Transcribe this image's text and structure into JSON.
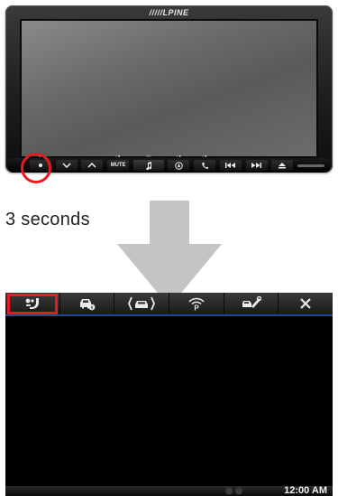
{
  "head_unit": {
    "brand": "/////LPINE",
    "buttons": {
      "power_sub": "•••",
      "mute_label": "MUTE",
      "mute_sub": "•◄",
      "music_sub": "•≡•",
      "nav_sub": "•◄",
      "phone_sub": "•◄"
    }
  },
  "caption": "3 seconds",
  "settings_screen": {
    "tabs": [
      {
        "name": "general-settings",
        "icon": "wrench-bolt-icon",
        "selected": true
      },
      {
        "name": "vehicle-info",
        "icon": "car-info-icon",
        "selected": false
      },
      {
        "name": "camera-settings",
        "icon": "car-camera-icon",
        "selected": false
      },
      {
        "name": "parking-wireless",
        "icon": "wireless-parking-icon",
        "selected": false
      },
      {
        "name": "car-tools",
        "icon": "car-wrench-icon",
        "selected": false
      },
      {
        "name": "close",
        "icon": "close-icon",
        "selected": false
      }
    ],
    "clock": "12:00 AM"
  },
  "colors": {
    "highlight": "#e41b23",
    "accent_line": "#1e4a8a",
    "arrow": "#c4c4c4"
  }
}
